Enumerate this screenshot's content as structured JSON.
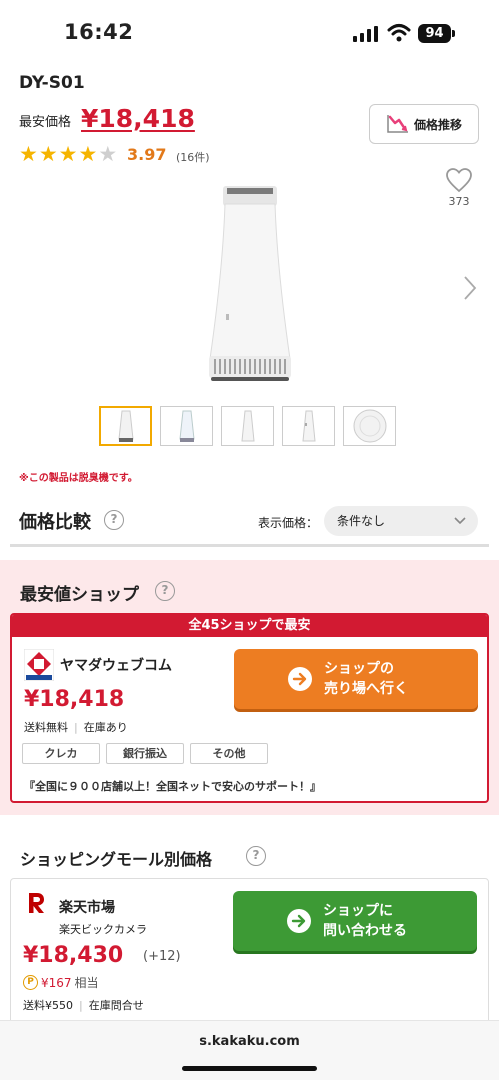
{
  "status_bar": {
    "time": "16:42",
    "battery": "94"
  },
  "product": {
    "name": "DY-S01",
    "lowest_label": "最安価格",
    "lowest_price": "¥18,418",
    "trend_button": "価格推移",
    "rating": 3.97,
    "rating_text": "3.97",
    "review_count": "(16件)",
    "favorites": "373",
    "note": "※この製品は脱臭機です。"
  },
  "compare": {
    "title": "価格比較",
    "display_price_label": "表示価格：",
    "condition": "条件なし"
  },
  "best_shop": {
    "title": "最安値ショップ",
    "banner": "全45ショップで最安",
    "shop_name": "ヤマダウェブコム",
    "price": "¥18,418",
    "shipping": "送料無料",
    "stock": "在庫あり",
    "payments": [
      "クレカ",
      "銀行振込",
      "その他"
    ],
    "catch_copy": "『全国に９００店舗以上！全国ネットで安心のサポート！』",
    "button": "ショップの\n売り場へ行く"
  },
  "mall": {
    "title": "ショッピングモール別価格",
    "mall_name": "楽天市場",
    "shop_name": "楽天ビックカメラ",
    "price": "¥18,430",
    "diff": "(+12)",
    "point_symbol": "P",
    "points": "¥167",
    "points_suffix": "相当",
    "shipping": "送料¥550",
    "stock": "在庫問合せ",
    "button": "ショップに\n問い合わせる"
  },
  "url_bar": {
    "url": "s.kakaku.com"
  },
  "icons": {
    "help": "?",
    "colors": {
      "price_red": "#d21a32",
      "star": "#f5b400",
      "orange_button": "#ed7d22",
      "green_button": "#3d9a35",
      "best_bg": "#fde8ea"
    }
  }
}
